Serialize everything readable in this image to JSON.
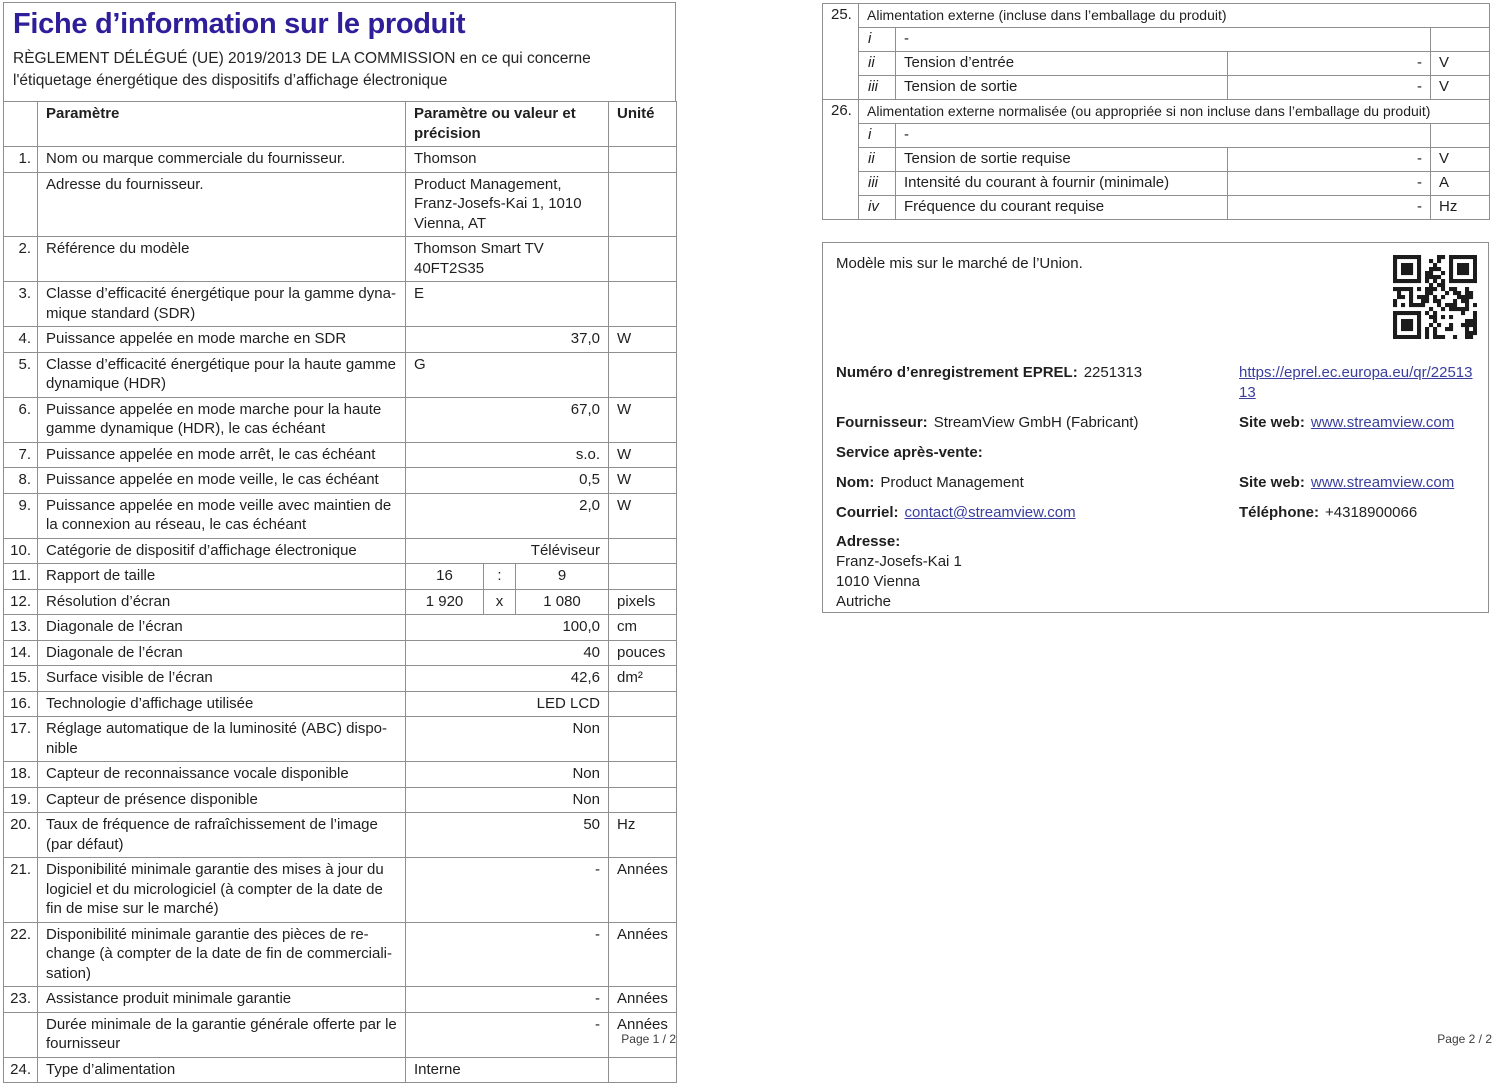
{
  "colors": {
    "title": "#2e1e99",
    "link": "#3a3f9e",
    "border": "#8f8f8f",
    "text": "#1f1f1f"
  },
  "page1": {
    "title": "Fiche d’information sur le produit",
    "subtitle": "RÈGLEMENT DÉLÉGUÉ (UE) 2019/2013 DE LA COMMISSION en ce qui concerne l'étiquetage énergétique des dispositifs d’affichage électronique",
    "table": {
      "headers": {
        "param": "Paramètre",
        "value": "Paramètre ou valeur et précision",
        "unit": "Unité"
      },
      "rows": [
        {
          "num": "1.",
          "label": "Nom ou marque commerciale du fournisseur.",
          "value": "Thomson",
          "unit": "",
          "align": "l"
        },
        {
          "num": "",
          "label": "Adresse du fournisseur.",
          "value": "Product Management,\nFranz-Josefs-Kai 1, 1010\nVienna, AT",
          "unit": "",
          "align": "l"
        },
        {
          "num": "2.",
          "label": "Référence du modèle",
          "value": "Thomson Smart TV\n40FT2S35",
          "unit": "",
          "align": "l"
        },
        {
          "num": "3.",
          "label": "Classe d’efficacité énergétique pour la gamme dyna­mique standard (SDR)",
          "value": "E",
          "unit": "",
          "align": "l"
        },
        {
          "num": "4.",
          "label": "Puissance appelée en mode marche en SDR",
          "value": "37,0",
          "unit": "W",
          "align": "r"
        },
        {
          "num": "5.",
          "label": "Classe d’efficacité énergétique pour la haute gamme dynamique (HDR)",
          "value": "G",
          "unit": "",
          "align": "l"
        },
        {
          "num": "6.",
          "label": "Puissance appelée en mode marche pour la haute gamme dynamique (HDR), le cas échéant",
          "value": "67,0",
          "unit": "W",
          "align": "r"
        },
        {
          "num": "7.",
          "label": "Puissance appelée en mode arrêt, le cas échéant",
          "value": "s.o.",
          "unit": "W",
          "align": "r"
        },
        {
          "num": "8.",
          "label": "Puissance appelée en mode veille, le cas échéant",
          "value": "0,5",
          "unit": "W",
          "align": "r"
        },
        {
          "num": "9.",
          "label": "Puissance appelée en mode veille avec maintien de la connexion au réseau, le cas échéant",
          "value": "2,0",
          "unit": "W",
          "align": "r"
        },
        {
          "num": "10.",
          "label": "Catégorie de dispositif d’affichage électronique",
          "value": "Téléviseur",
          "unit": "",
          "align": "r"
        },
        {
          "num": "11.",
          "label": "Rapport de taille",
          "triple": [
            "16",
            ":",
            "9"
          ],
          "unit": ""
        },
        {
          "num": "12.",
          "label": "Résolution d’écran",
          "triple": [
            "1 920",
            "x",
            "1 080"
          ],
          "unit": "pixels"
        },
        {
          "num": "13.",
          "label": "Diagonale de l’écran",
          "value": "100,0",
          "unit": "cm",
          "align": "r"
        },
        {
          "num": "14.",
          "label": "Diagonale de l’écran",
          "value": "40",
          "unit": "pouces",
          "align": "r"
        },
        {
          "num": "15.",
          "label": "Surface visible de l’écran",
          "value": "42,6",
          "unit": "dm²",
          "align": "r"
        },
        {
          "num": "16.",
          "label": "Technologie d’affichage utilisée",
          "value": "LED LCD",
          "unit": "",
          "align": "r"
        },
        {
          "num": "17.",
          "label": "Réglage automatique de la luminosité (ABC) dispo­nible",
          "value": "Non",
          "unit": "",
          "align": "r"
        },
        {
          "num": "18.",
          "label": "Capteur de reconnaissance vocale disponible",
          "value": "Non",
          "unit": "",
          "align": "r"
        },
        {
          "num": "19.",
          "label": "Capteur de présence disponible",
          "value": "Non",
          "unit": "",
          "align": "r"
        },
        {
          "num": "20.",
          "label": "Taux de fréquence de rafraîchissement de l’image (par défaut)",
          "value": "50",
          "unit": "Hz",
          "align": "r"
        },
        {
          "num": "21.",
          "label": "Disponibilité minimale garantie des mises à jour du logiciel et du micrologiciel (à compter de la date de fin de mise sur le marché)",
          "value": "-",
          "unit": "Années",
          "align": "r"
        },
        {
          "num": "22.",
          "label": "Disponibilité minimale garantie des pièces de re­change (à compter de la date de fin de commerciali­sation)",
          "value": "-",
          "unit": "Années",
          "align": "r"
        },
        {
          "num": "23.",
          "label": "Assistance produit minimale garantie",
          "value": "-",
          "unit": "Années",
          "align": "r"
        },
        {
          "num": "",
          "label": "Durée minimale de la garantie générale offerte par le fournisseur",
          "value": "-",
          "unit": "Années",
          "align": "r"
        },
        {
          "num": "24.",
          "label": "Type d’alimentation",
          "value": "Interne",
          "unit": "",
          "align": "l"
        }
      ]
    },
    "footer": "Page 1 / 2"
  },
  "page2": {
    "table": {
      "sections": [
        {
          "num": "25.",
          "title": "Alimentation externe (incluse dans l’emballage du produit)",
          "rows": [
            {
              "roman": "i",
              "label": "-",
              "span": true
            },
            {
              "roman": "ii",
              "label": "Tension d’entrée",
              "value": "-",
              "unit": "V"
            },
            {
              "roman": "iii",
              "label": "Tension de sortie",
              "value": "-",
              "unit": "V"
            }
          ]
        },
        {
          "num": "26.",
          "title": "Alimentation externe normalisée (ou appropriée si non incluse dans l’emballage du produit)",
          "rows": [
            {
              "roman": "i",
              "label": "-",
              "span": true
            },
            {
              "roman": "ii",
              "label": "Tension de sortie requise",
              "value": "-",
              "unit": "V"
            },
            {
              "roman": "iii",
              "label": "Intensité du courant à fournir (minimale)",
              "value": "-",
              "unit": "A"
            },
            {
              "roman": "iv",
              "label": "Fréquence du courant requise",
              "value": "-",
              "unit": "Hz"
            }
          ]
        }
      ]
    },
    "info_box": {
      "intro": "Modèle mis sur le marché de l’Union.",
      "eprel_label": "Numéro d’enregistrement EPREL:",
      "eprel_value": "2251313",
      "eprel_link": "https://eprel.ec.europa.eu/qr/2251313",
      "fournisseur_label": "Fournisseur:",
      "fournisseur_value": "StreamView GmbH (Fabricant)",
      "site_label": "Site web:",
      "site_link": "www.streamview.com",
      "service_label": "Service après-vente:",
      "nom_label": "Nom:",
      "nom_value": "Product Management",
      "site2_label": "Site web:",
      "site2_link": "www.streamview.com",
      "courriel_label": "Courriel:",
      "courriel_link": "contact@streamview.com",
      "telephone_label": "Téléphone:",
      "telephone_value": "+4318900066",
      "adresse_label": "Adresse:",
      "adresse_lines": [
        "Franz-Josefs-Kai 1",
        "1010 Vienna",
        "Autriche"
      ]
    },
    "footer": "Page 2 / 2"
  }
}
